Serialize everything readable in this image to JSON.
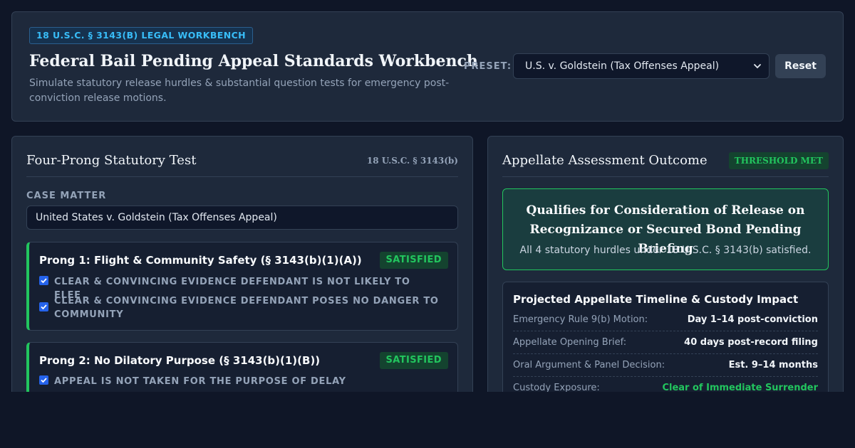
{
  "header": {
    "badge": "18 U.S.C. § 3143(B) LEGAL WORKBENCH",
    "title": "Federal Bail Pending Appeal Standards Workbench",
    "subtitle": "Simulate statutory release hurdles & substantial question tests for emergency post-conviction release motions.",
    "preset_label": "PRESET:",
    "preset_value": "U.S. v. Goldstein (Tax Offenses Appeal)",
    "reset_label": "Reset"
  },
  "left_panel": {
    "title": "Four-Prong Statutory Test",
    "citation": "18 U.S.C. § 3143(b)",
    "case_label": "CASE MATTER",
    "case_value": "United States v. Goldstein (Tax Offenses Appeal)",
    "prongs": [
      {
        "title": "Prong 1: Flight & Community Safety (§ 3143(b)(1)(A))",
        "status": "SATISFIED",
        "checks": [
          {
            "text": "CLEAR & CONVINCING EVIDENCE DEFENDANT IS NOT LIKELY TO FLEE",
            "checked": true
          },
          {
            "text": "CLEAR & CONVINCING EVIDENCE DEFENDANT POSES NO DANGER TO COMMUNITY",
            "checked": true
          }
        ]
      },
      {
        "title": "Prong 2: No Dilatory Purpose (§ 3143(b)(1)(B))",
        "status": "SATISFIED",
        "checks": [
          {
            "text": "APPEAL IS NOT TAKEN FOR THE PURPOSE OF DELAY",
            "checked": true
          }
        ]
      }
    ]
  },
  "right_panel": {
    "title": "Appellate Assessment Outcome",
    "status": "THRESHOLD MET",
    "outcome_title": "Qualifies for Consideration of Release on Recognizance or Secured Bond Pending Briefing",
    "outcome_sub": "All 4 statutory hurdles under 18 U.S.C. § 3143(b) satisfied.",
    "timeline_title": "Projected Appellate Timeline & Custody Impact",
    "timeline": [
      {
        "label": "Emergency Rule 9(b) Motion:",
        "value": "Day 1–14 post-conviction"
      },
      {
        "label": "Appellate Opening Brief:",
        "value": "40 days post-record filing"
      },
      {
        "label": "Oral Argument & Panel Decision:",
        "value": "Est. 9–14 months"
      },
      {
        "label": "Custody Exposure:",
        "value": "Clear of Immediate Surrender"
      }
    ]
  },
  "colors": {
    "background": "#0f1627",
    "panel": "#1e293b",
    "accent_blue": "#38bdf8",
    "success_green": "#22c55e"
  }
}
